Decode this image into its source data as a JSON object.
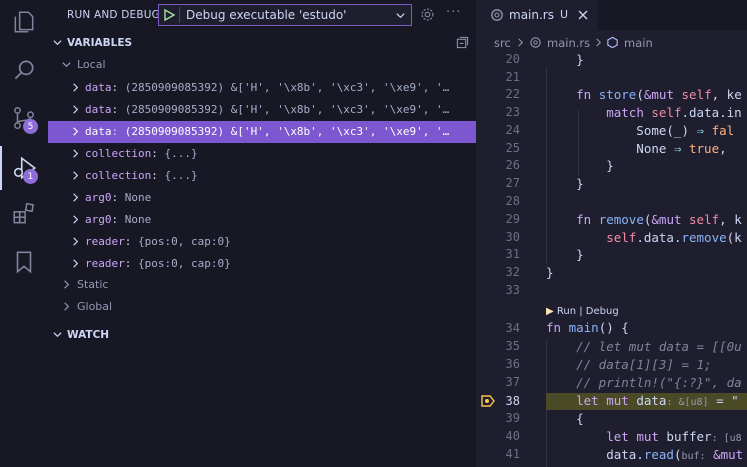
{
  "sidebar": {
    "title": "RUN AND DEBUG",
    "config_name": "Debug executable 'estudo'",
    "variables_label": "VARIABLES",
    "local_label": "Local",
    "variables": [
      {
        "name": "data",
        "value": "(2850909085392) &['H', '\\x8b', '\\xc3', '\\xe9', '…"
      },
      {
        "name": "data",
        "value": "(2850909085392) &['H', '\\x8b', '\\xc3', '\\xe9', '…"
      },
      {
        "name": "data",
        "value": "(2850909085392) &['H', '\\x8b', '\\xc3', '\\xe9', '…"
      },
      {
        "name": "collection",
        "value": "{...}"
      },
      {
        "name": "collection",
        "value": "{...}"
      },
      {
        "name": "arg0",
        "value": "None"
      },
      {
        "name": "arg0",
        "value": "None"
      },
      {
        "name": "reader",
        "value": "{pos:0, cap:0}"
      },
      {
        "name": "reader",
        "value": "{pos:0, cap:0}"
      }
    ],
    "static_label": "Static",
    "global_label": "Global",
    "watch_label": "WATCH",
    "more": "···"
  },
  "activity": {
    "source_control_badge": "5",
    "debug_badge": "1"
  },
  "editor": {
    "tab_name": "main.rs",
    "tab_status": "U",
    "breadcrumb": [
      "src",
      "main.rs",
      "main"
    ],
    "codelens": "Run | Debug",
    "line_numbers": [
      "20",
      "21",
      "22",
      "23",
      "24",
      "25",
      "26",
      "27",
      "28",
      "29",
      "30",
      "31",
      "32",
      "33",
      "34",
      "35",
      "36",
      "37",
      "38",
      "39",
      "40",
      "41"
    ]
  },
  "colors": {
    "accent": "#7c57cf",
    "badge": "#8f6dd8",
    "current_line": "#4b4a26",
    "breakpoint_arrow": "#f9c74f"
  }
}
